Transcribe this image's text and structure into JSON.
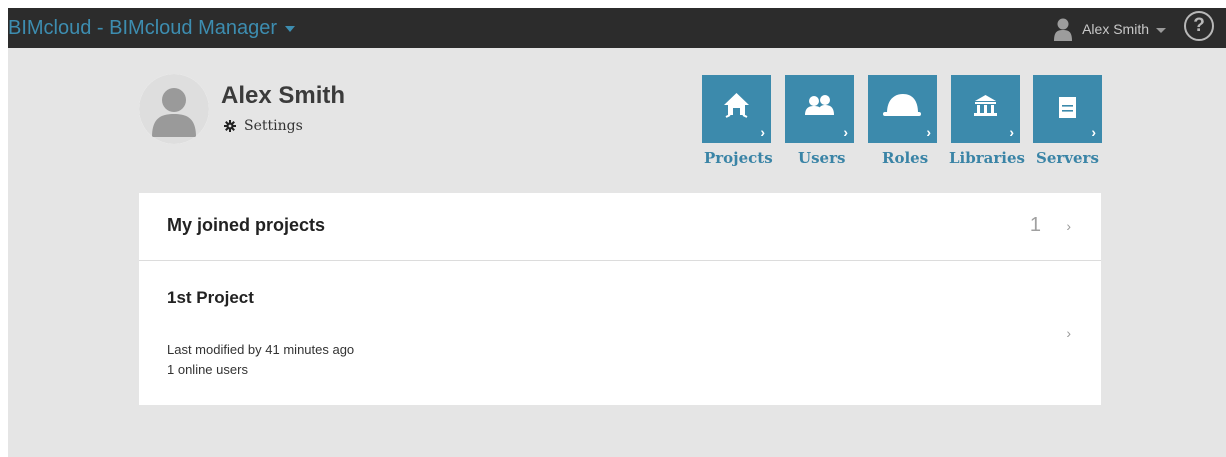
{
  "header": {
    "app_title": "BIMcloud - BIMcloud Manager",
    "user_name": "Alex Smith",
    "help_glyph": "?"
  },
  "profile": {
    "name": "Alex Smith",
    "settings_label": "Settings"
  },
  "nav_tiles": [
    {
      "label": "Projects",
      "icon": "house-icon"
    },
    {
      "label": "Users",
      "icon": "users-icon"
    },
    {
      "label": "Roles",
      "icon": "hardhat-icon"
    },
    {
      "label": "Libraries",
      "icon": "library-icon"
    },
    {
      "label": "Servers",
      "icon": "server-icon"
    }
  ],
  "joined": {
    "title": "My joined projects",
    "count": "1",
    "chevron": "›"
  },
  "projects": [
    {
      "name": "1st Project",
      "last_modified": "Last modified by 41 minutes ago",
      "online": "1 online users",
      "chevron": "›"
    }
  ],
  "colors": {
    "accent": "#3c8aac",
    "title_blue": "#3d8db0",
    "topbar": "#2c2c2c",
    "page_bg": "#e5e5e5"
  }
}
